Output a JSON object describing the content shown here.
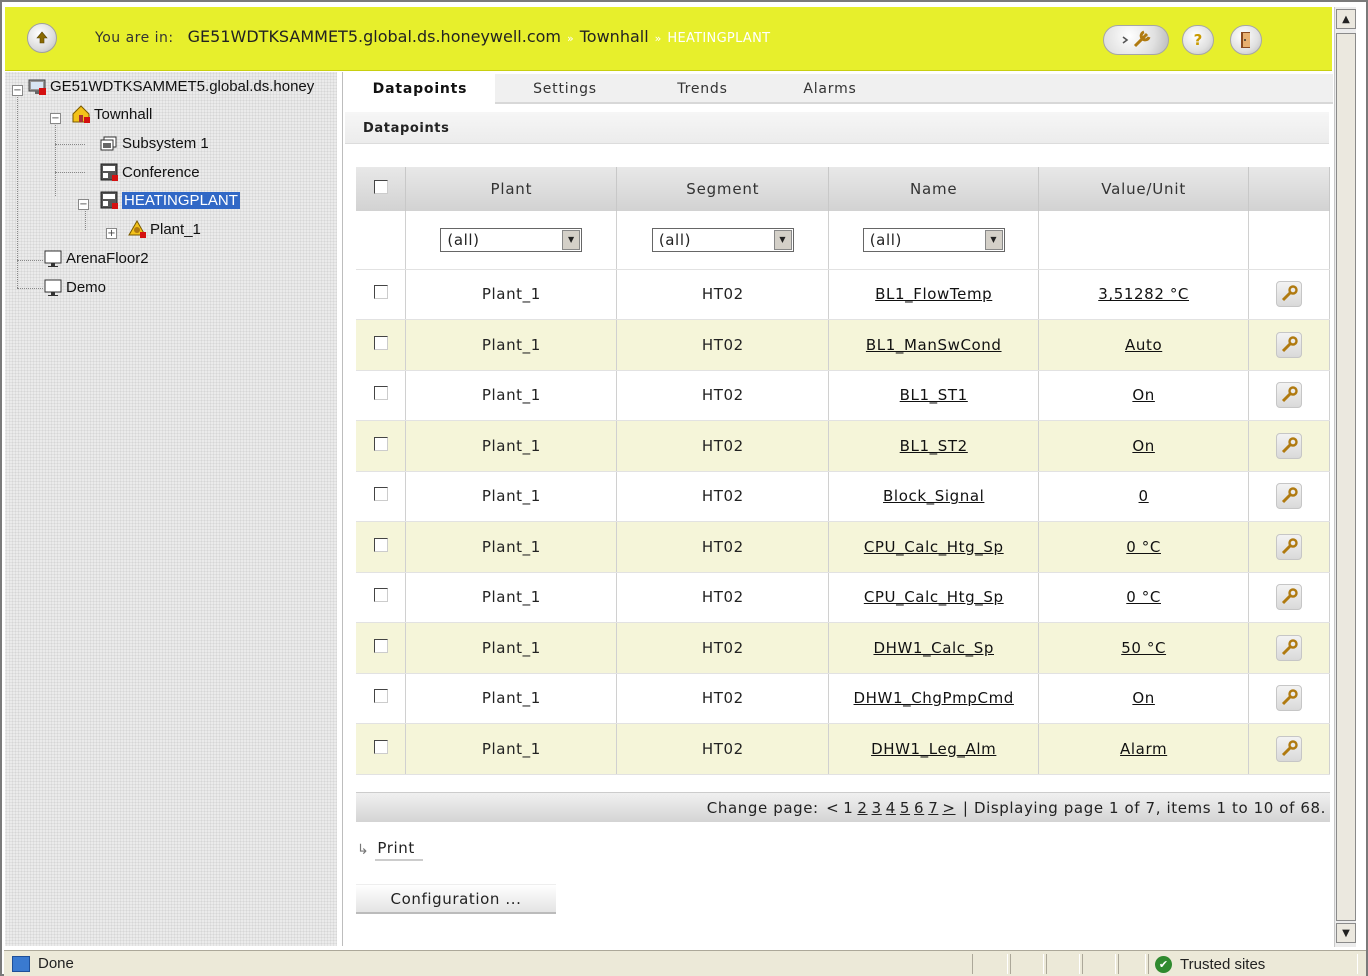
{
  "header": {
    "you_are_in": "You are in:",
    "crumbs": [
      "GE51WDTKSAMMET5.global.ds.honeywell.com",
      "Townhall",
      "HEATINGPLANT"
    ],
    "separator": "»",
    "help_label": "?"
  },
  "tree": {
    "root": "GE51WDTKSAMMET5.global.ds.honey",
    "townhall": "Townhall",
    "subsystem": "Subsystem 1",
    "conference": "Conference",
    "heatingplant": "HEATINGPLANT",
    "plant": "Plant_1",
    "arena": "ArenaFloor2",
    "demo": "Demo"
  },
  "tabs": [
    "Datapoints",
    "Settings",
    "Trends",
    "Alarms"
  ],
  "section_title": "Datapoints",
  "table": {
    "headers": [
      "Plant",
      "Segment",
      "Name",
      "Value/Unit"
    ],
    "filters": [
      "(all)",
      "(all)",
      "(all)"
    ],
    "rows": [
      {
        "plant": "Plant_1",
        "segment": "HT02",
        "name": "BL1_FlowTemp",
        "value": "3,51282 °C"
      },
      {
        "plant": "Plant_1",
        "segment": "HT02",
        "name": "BL1_ManSwCond",
        "value": "Auto"
      },
      {
        "plant": "Plant_1",
        "segment": "HT02",
        "name": "BL1_ST1",
        "value": "On"
      },
      {
        "plant": "Plant_1",
        "segment": "HT02",
        "name": "BL1_ST2",
        "value": "On"
      },
      {
        "plant": "Plant_1",
        "segment": "HT02",
        "name": "Block_Signal",
        "value": "0"
      },
      {
        "plant": "Plant_1",
        "segment": "HT02",
        "name": "CPU_Calc_Htg_Sp",
        "value": "0 °C"
      },
      {
        "plant": "Plant_1",
        "segment": "HT02",
        "name": "CPU_Calc_Htg_Sp",
        "value": "0 °C"
      },
      {
        "plant": "Plant_1",
        "segment": "HT02",
        "name": "DHW1_Calc_Sp",
        "value": "50 °C"
      },
      {
        "plant": "Plant_1",
        "segment": "HT02",
        "name": "DHW1_ChgPmpCmd",
        "value": "On"
      },
      {
        "plant": "Plant_1",
        "segment": "HT02",
        "name": "DHW1_Leg_Alm",
        "value": "Alarm"
      }
    ]
  },
  "pager": {
    "change_label": "Change page:",
    "prev": "<",
    "current": "1",
    "pages": [
      "2",
      "3",
      "4",
      "5",
      "6",
      "7"
    ],
    "next": ">",
    "divider": "|",
    "summary": "Displaying page 1 of 7, items 1 to 10 of 68."
  },
  "buttons": {
    "print": "Print",
    "configuration": "Configuration ..."
  },
  "statusbar": {
    "done": "Done",
    "zone": "Trusted sites"
  },
  "colors": {
    "header_bg": "#e7ef2c",
    "row_alt": "#f5f5d9",
    "selection": "#3168c6"
  }
}
